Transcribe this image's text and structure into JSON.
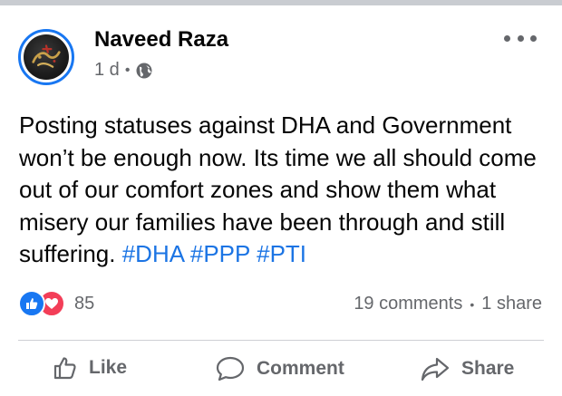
{
  "post": {
    "author": "Naveed Raza",
    "time": "1 d",
    "visibility_icon": "globe-icon",
    "text_main": "Posting statuses against DHA and Government won’t be enough now. Its time we all should come out of our comfort zones and show them what misery our families have been through and still suffering.",
    "hashtags": [
      "#DHA",
      "#PPP",
      "#PTI"
    ]
  },
  "engagement": {
    "reaction_icons": [
      "like-reaction-icon",
      "love-reaction-icon"
    ],
    "reaction_count": "85",
    "comments": "19 comments",
    "shares": "1 share"
  },
  "actions": {
    "like": "Like",
    "comment": "Comment",
    "share": "Share"
  },
  "colors": {
    "link": "#1b74e4",
    "secondary_text": "#65676b",
    "like_blue": "#1877f2",
    "love_red": "#f33e58"
  }
}
